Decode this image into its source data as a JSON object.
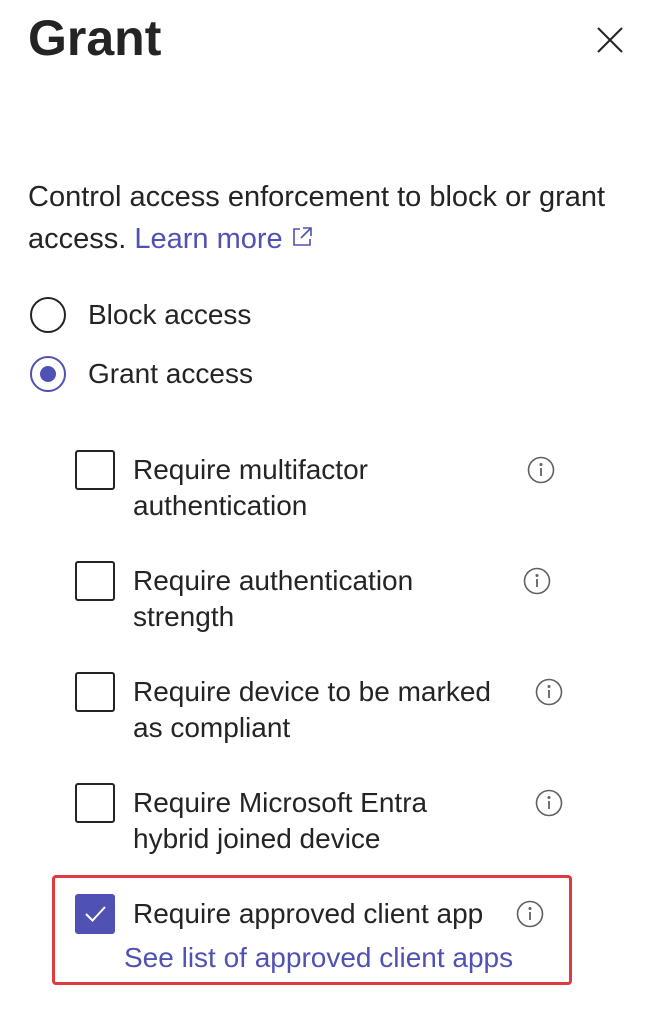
{
  "panel": {
    "title": "Grant",
    "close_icon": "close-icon"
  },
  "description": {
    "text": "Control access enforcement to block or grant access.",
    "learn_more": "Learn more",
    "external_icon": "external-link-icon"
  },
  "access_options": [
    {
      "label": "Block access",
      "selected": false
    },
    {
      "label": "Grant access",
      "selected": true
    }
  ],
  "grant_controls": [
    {
      "label": "Require multifactor authentication",
      "checked": false,
      "info_icon": "info-icon"
    },
    {
      "label": "Require authentication strength",
      "checked": false,
      "info_icon": "info-icon"
    },
    {
      "label": "Require device to be marked as compliant",
      "checked": false,
      "info_icon": "info-icon"
    },
    {
      "label": "Require Microsoft Entra hybrid joined device",
      "checked": false,
      "info_icon": "info-icon"
    },
    {
      "label": "Require approved client app",
      "checked": true,
      "info_icon": "info-icon",
      "link": "See list of approved client apps"
    }
  ],
  "colors": {
    "accent": "#4f52b2",
    "highlight": "#e03a40",
    "text": "#242424"
  }
}
